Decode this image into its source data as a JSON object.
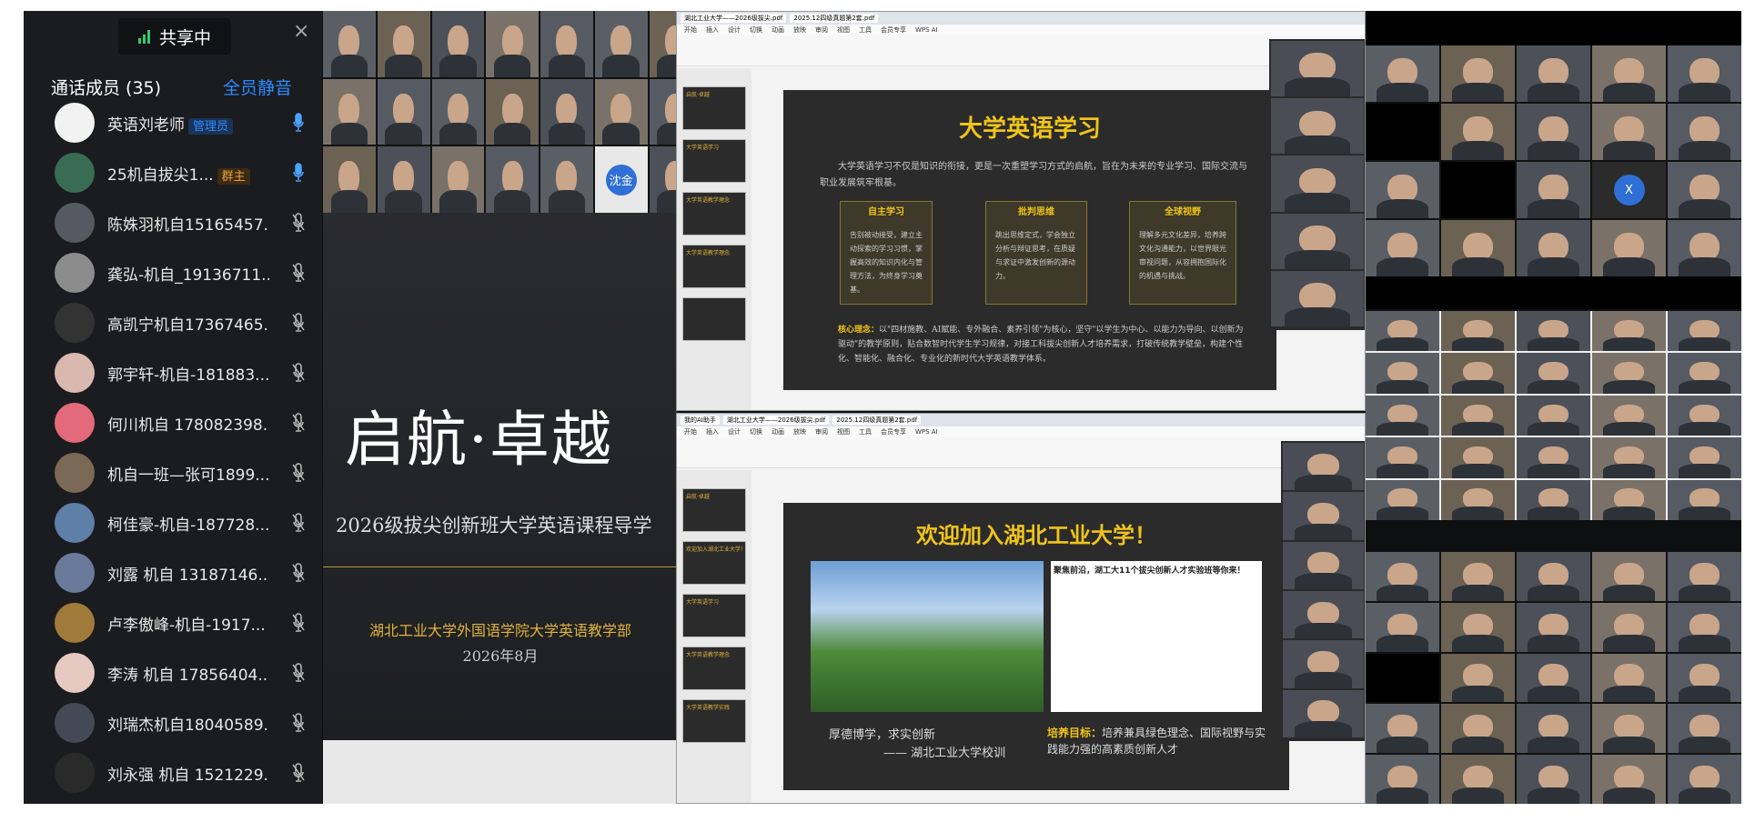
{
  "sidebar": {
    "share_status": "共享中",
    "close": "×",
    "members_title": "通话成员 (35)",
    "mute_all": "全员静音",
    "members": [
      {
        "name": "英语刘老师",
        "badge": "管理员",
        "badge_color": "#2b8cff",
        "mic": "on",
        "avatar_color": "#f2f2f2"
      },
      {
        "name": "25机自拔尖1...",
        "badge": "群主",
        "badge_color": "#e8a23a",
        "mic": "on",
        "avatar_color": "#3a6b53"
      },
      {
        "name": "陈姝羽机自15165457...",
        "badge": "",
        "mic": "muted",
        "avatar_color": "#555a62"
      },
      {
        "name": "龚弘-机自_19136711...",
        "badge": "",
        "mic": "muted",
        "avatar_color": "#8c8c8c"
      },
      {
        "name": "高凯宁机自17367465...",
        "badge": "",
        "mic": "muted",
        "avatar_color": "#333"
      },
      {
        "name": "郭宇轩-机自-181883...",
        "badge": "",
        "mic": "muted",
        "avatar_color": "#d9b8b0"
      },
      {
        "name": "何川机自 178082398...",
        "badge": "",
        "mic": "muted",
        "avatar_color": "#e36a7a"
      },
      {
        "name": "机自一班—张可1899...",
        "badge": "",
        "mic": "muted",
        "avatar_color": "#7a6a55"
      },
      {
        "name": "柯佳豪-机自-187728...",
        "badge": "",
        "mic": "muted",
        "avatar_color": "#5d7fa8"
      },
      {
        "name": "刘露 机自 13187146...",
        "badge": "",
        "mic": "muted",
        "avatar_color": "#6a7a9a"
      },
      {
        "name": "卢李傲峰-机自-1917...",
        "badge": "",
        "mic": "muted",
        "avatar_color": "#a07a3a"
      },
      {
        "name": "李涛 机自 17856404...",
        "badge": "",
        "mic": "muted",
        "avatar_color": "#e6c9c0"
      },
      {
        "name": "刘瑞杰机自18040589...",
        "badge": "",
        "mic": "muted",
        "avatar_color": "#444a55"
      },
      {
        "name": "刘永强 机自 1521229...",
        "badge": "",
        "mic": "muted",
        "avatar_color": "#2a2a2a"
      }
    ]
  },
  "left_slide": {
    "title": "启航·卓越",
    "subtitle": "2026级拔尖创新班大学英语课程导学",
    "org": "湖北工业大学外国语学院大学英语教学部",
    "date": "2026年8月"
  },
  "gallery_top": {
    "names": [
      "",
      "",
      "",
      "",
      "",
      "",
      "",
      "",
      "",
      "",
      "",
      "",
      "",
      "",
      "",
      "",
      "",
      "",
      "",
      "",
      "",
      "沈金",
      "",
      ""
    ],
    "avatar_letter": "沈金"
  },
  "ppt_top": {
    "tabs": [
      "湖北工业大学——2026级拔尖.pdf",
      "2025.12四级真题第2套.pdf"
    ],
    "menu": [
      "开始",
      "插入",
      "设计",
      "切换",
      "动画",
      "放映",
      "审阅",
      "视图",
      "工具",
      "会员专享",
      "WPS AI"
    ],
    "slide_title": "大学英语学习",
    "intro": "大学英语学习不仅是知识的衔接，更是一次重塑学习方式的启航，旨在为未来的专业学习、国际交流与职业发展筑牢根基。",
    "cards": [
      {
        "title": "自主学习",
        "text": "告别被动接受，建立主动探索的学习习惯，掌握高效的知识内化与管理方法，为终身学习奠基。"
      },
      {
        "title": "批判思维",
        "text": "跳出思维定式，学会独立分析与辩证思考，在质疑与求证中激发创新的源动力。"
      },
      {
        "title": "全球视野",
        "text": "理解多元文化差异，培养跨文化沟通能力，以世界眼光审视问题，从容拥抱国际化的机遇与挑战。"
      }
    ],
    "core_label": "核心理念：",
    "core_text": "以\"四材施教、AI赋能、专外融合、素养引领\"为核心，坚守\"以学生为中心、以能力为导向、以创新为驱动\"的教学原则，贴合数智时代学生学习规律，对接工科拔尖创新人才培养需求，打破传统教学壁垒，构建个性化、智能化、融合化、专业化的新时代大学英语教学体系。",
    "thumb_labels": [
      "启航·卓越",
      "大学英语学习",
      "大学英语教学理念",
      "大学英语教学理念",
      ""
    ]
  },
  "ppt_bottom": {
    "tabs": [
      "我的AI助手",
      "湖北工业大学——2026级拔尖.pdf",
      "2025.12四级真题第2套.pdf"
    ],
    "menu": [
      "开始",
      "插入",
      "设计",
      "切换",
      "动画",
      "放映",
      "审阅",
      "视图",
      "工具",
      "会员专享",
      "WPS AI"
    ],
    "slide_title": "欢迎加入湖北工业大学！",
    "news_title": "聚焦前沿，湖工大11个拔尖创新人才实验班等你来！",
    "motto": "厚德博学，求实创新",
    "motto_src": "—— 湖北工业大学校训",
    "goal_label": "培养目标：",
    "goal_text": "培养兼具绿色理念、国际视野与实践能力强的高素质创新人才",
    "thumb_labels": [
      "启航·卓越",
      "欢迎加入湖北工业大学！",
      "大学英语学习",
      "大学英语教学理念",
      "大学英语教学实践"
    ]
  },
  "right_panel": {
    "avatar_letter": "X"
  }
}
